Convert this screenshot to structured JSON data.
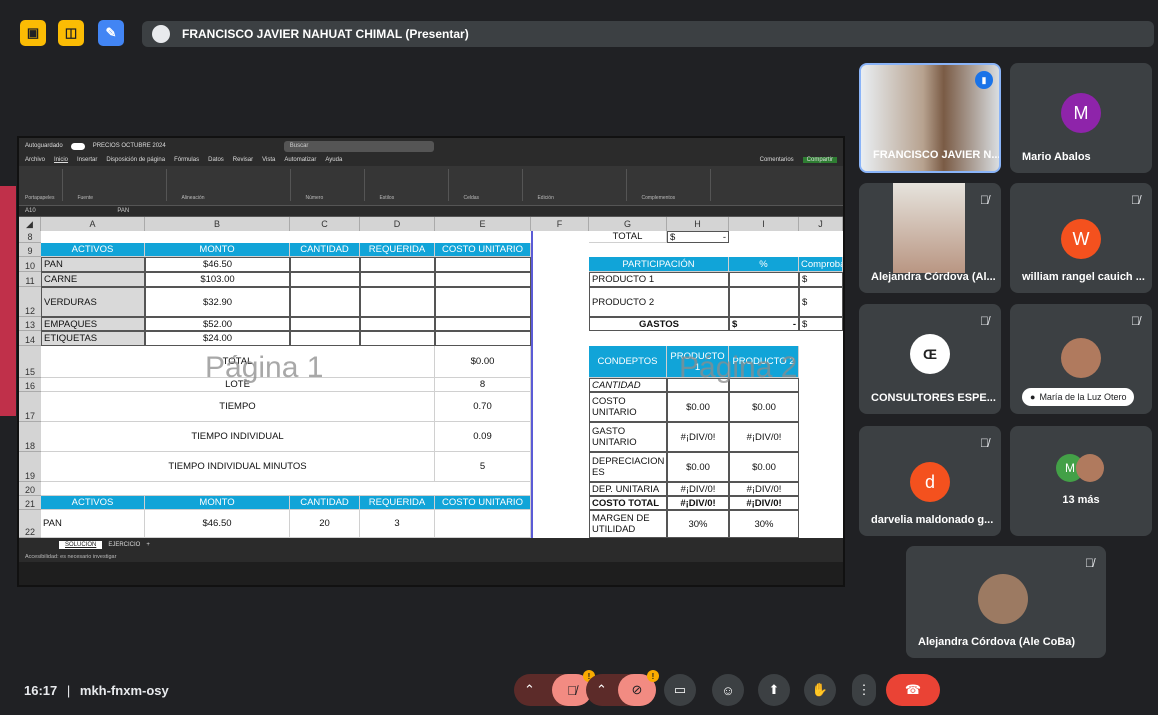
{
  "presenter_bar": {
    "text": "FRANCISCO JAVIER NAHUAT CHIMAL (Presentar)"
  },
  "excel": {
    "title_left": "Autoguardado",
    "file_name": "PRECIOS OCTUBRE 2024",
    "search_placeholder": "Buscar",
    "menu": [
      "Archivo",
      "Inicio",
      "Insertar",
      "Disposición de página",
      "Fórmulas",
      "Datos",
      "Revisar",
      "Vista",
      "Automatizar",
      "Ayuda"
    ],
    "comments": "Comentarios",
    "share": "Compartir",
    "ribbon_groups": [
      "Portapapeles",
      "Fuente",
      "Alineación",
      "Número",
      "Estilos",
      "Celdas",
      "Edición",
      "Complementos"
    ],
    "name_box": "A10",
    "formula": "PAN",
    "sheet_tabs": [
      "SOLUCION",
      "EJERCICIO"
    ],
    "status": "Accesibilidad: es necesario investigar",
    "watermark1": "Página 1",
    "watermark2": "Página 2",
    "columns": [
      "A",
      "B",
      "C",
      "D",
      "E",
      "F",
      "G",
      "H",
      "I",
      "J"
    ],
    "rows": [
      "8",
      "9",
      "10",
      "11",
      "12",
      "13",
      "14",
      "15",
      "16",
      "17",
      "18",
      "19",
      "20",
      "21",
      "22"
    ],
    "left": {
      "headers": [
        "ACTIVOS",
        "MONTO",
        "CANTIDAD",
        "REQUERIDA",
        "COSTO UNITARIO"
      ],
      "items": [
        {
          "name": "PAN",
          "monto": "$46.50"
        },
        {
          "name": "CARNE",
          "monto": "$103.00"
        },
        {
          "name": "VERDURAS",
          "monto": "$32.90"
        },
        {
          "name": "EMPAQUES",
          "monto": "$52.00"
        },
        {
          "name": "ETIQUETAS",
          "monto": "$24.00"
        }
      ],
      "total_label": "TOTAL",
      "total_value": "$0.00",
      "lote_label": "LOTE",
      "lote_value": "8",
      "tiempo_label": "TIEMPO",
      "tiempo_value": "0.70",
      "ti_label": "TIEMPO INDIVIDUAL",
      "ti_value": "0.09",
      "tim_label": "TIEMPO INDIVIDUAL MINUTOS",
      "tim_value": "5",
      "row22": {
        "name": "PAN",
        "monto": "$46.50",
        "cantidad": "20",
        "requerida": "3"
      }
    },
    "right": {
      "total_label": "TOTAL",
      "total_cur": "$",
      "total_dash": "-",
      "part_header": "PARTICIPACIÓN",
      "pct_header": "%",
      "comp_header": "Comproba",
      "p1": "PRODUCTO 1",
      "p2": "PRODUCTO 2",
      "cur": "$",
      "gastos": "GASTOS",
      "gastos_cur": "$",
      "gastos_dash": "-",
      "gastos_cur2": "$",
      "conceptos": "CONDEPTOS",
      "prod1": "PRODUCTO 1",
      "prod2": "PRODUCTO 2",
      "cantidad": "CANTIDAD",
      "costo_unit": "COSTO UNITARIO",
      "cu1": "$0.00",
      "cu2": "$0.00",
      "gasto_unit": "GASTO UNITARIO",
      "gu1": "#¡DIV/0!",
      "gu2": "#¡DIV/0!",
      "deprec": "DEPRECIACION ES",
      "d1": "$0.00",
      "d2": "$0.00",
      "dep_unit": "DEP. UNITARIA",
      "du1": "#¡DIV/0!",
      "du2": "#¡DIV/0!",
      "costo_total": "COSTO TOTAL",
      "ct1": "#¡DIV/0!",
      "ct2": "#¡DIV/0!",
      "margen": "MARGEN DE UTILIDAD",
      "m1": "30%",
      "m2": "30%"
    }
  },
  "participants": [
    {
      "name": "FRANCISCO JAVIER N...",
      "speaking": true
    },
    {
      "name": "Mario Abalos",
      "initial": "M",
      "color": "#8e24aa"
    },
    {
      "name": "Alejandra Córdova (Al...",
      "muted": true
    },
    {
      "name": "william rangel cauich ...",
      "initial": "W",
      "color": "#f4511e",
      "muted": true
    },
    {
      "name": "CONSULTORES ESPE...",
      "muted": true
    },
    {
      "name": "María de la Luz Otero",
      "muted": true
    },
    {
      "name": "darvelia maldonado g...",
      "initial": "d",
      "color": "#f4511e",
      "muted": true
    },
    {
      "name": "13 más",
      "initial": "M",
      "color": "#43a047"
    },
    {
      "name": "Alejandra Córdova (Ale CoBa)",
      "muted": true
    }
  ],
  "bottom": {
    "time": "16:17",
    "separator": "|",
    "code": "mkh-fnxm-osy",
    "badge": "!"
  },
  "colors": {
    "bg": "#202124",
    "tile": "#3c4043",
    "header": "#11a4d8",
    "end_call": "#ea4335",
    "mic_off": "#f28b82"
  }
}
